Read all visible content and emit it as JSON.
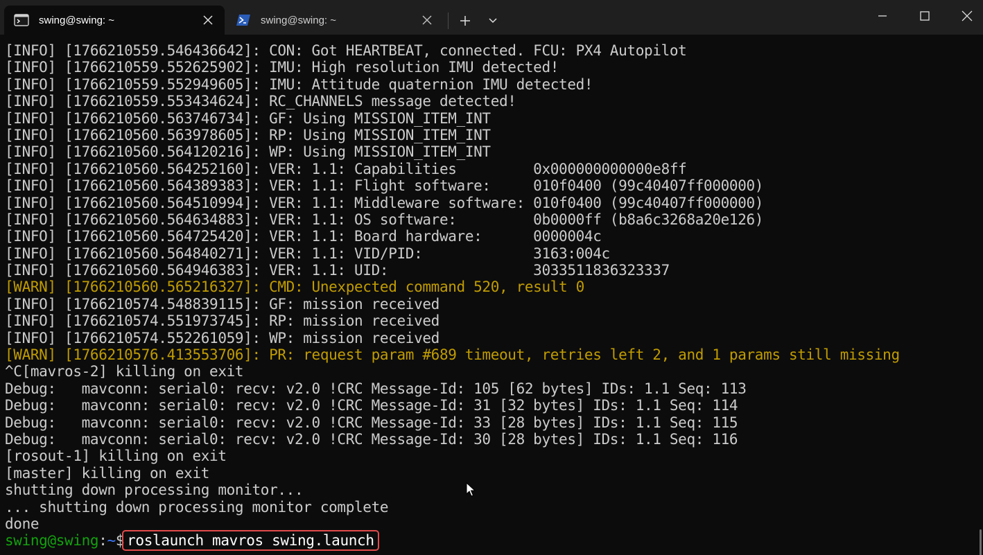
{
  "window": {
    "tabs": [
      {
        "title": "swing@swing: ~",
        "icon": "terminal-icon",
        "active": true
      },
      {
        "title": "swing@swing: ~",
        "icon": "powershell-icon",
        "active": false
      }
    ],
    "controls": [
      "minimize-icon",
      "maximize-icon",
      "close-icon"
    ]
  },
  "colors": {
    "text": "#cccccc",
    "warn": "#c19c00",
    "prompt_user": "#13a10e",
    "prompt_path": "#3b78ff",
    "highlight_box": "#e34b4b"
  },
  "terminal": {
    "lines": [
      {
        "text": "[INFO] [1766210559.546436642]: CON: Got HEARTBEAT, connected. FCU: PX4 Autopilot",
        "level": "info"
      },
      {
        "text": "[INFO] [1766210559.552625902]: IMU: High resolution IMU detected!",
        "level": "info"
      },
      {
        "text": "[INFO] [1766210559.552949605]: IMU: Attitude quaternion IMU detected!",
        "level": "info"
      },
      {
        "text": "[INFO] [1766210559.553434624]: RC_CHANNELS message detected!",
        "level": "info"
      },
      {
        "text": "[INFO] [1766210560.563746734]: GF: Using MISSION_ITEM_INT",
        "level": "info"
      },
      {
        "text": "[INFO] [1766210560.563978605]: RP: Using MISSION_ITEM_INT",
        "level": "info"
      },
      {
        "text": "[INFO] [1766210560.564120216]: WP: Using MISSION_ITEM_INT",
        "level": "info"
      },
      {
        "text": "[INFO] [1766210560.564252160]: VER: 1.1: Capabilities         0x000000000000e8ff",
        "level": "info"
      },
      {
        "text": "[INFO] [1766210560.564389383]: VER: 1.1: Flight software:     010f0400 (99c40407ff000000)",
        "level": "info"
      },
      {
        "text": "[INFO] [1766210560.564510994]: VER: 1.1: Middleware software: 010f0400 (99c40407ff000000)",
        "level": "info"
      },
      {
        "text": "[INFO] [1766210560.564634883]: VER: 1.1: OS software:         0b0000ff (b8a6c3268a20e126)",
        "level": "info"
      },
      {
        "text": "[INFO] [1766210560.564725420]: VER: 1.1: Board hardware:      0000004c",
        "level": "info"
      },
      {
        "text": "[INFO] [1766210560.564840271]: VER: 1.1: VID/PID:             3163:004c",
        "level": "info"
      },
      {
        "text": "[INFO] [1766210560.564946383]: VER: 1.1: UID:                 3033511836323337",
        "level": "info"
      },
      {
        "text": "[WARN] [1766210560.565216327]: CMD: Unexpected command 520, result 0",
        "level": "warn"
      },
      {
        "text": "[INFO] [1766210574.548839115]: GF: mission received",
        "level": "info"
      },
      {
        "text": "[INFO] [1766210574.551973745]: RP: mission received",
        "level": "info"
      },
      {
        "text": "[INFO] [1766210574.552261059]: WP: mission received",
        "level": "info"
      },
      {
        "text": "[WARN] [1766210576.413553706]: PR: request param #689 timeout, retries left 2, and 1 params still missing",
        "level": "warn"
      },
      {
        "text": "^C[mavros-2] killing on exit",
        "level": "plain"
      },
      {
        "text": "Debug:   mavconn: serial0: recv: v2.0 !CRC Message-Id: 105 [62 bytes] IDs: 1.1 Seq: 113",
        "level": "plain"
      },
      {
        "text": "Debug:   mavconn: serial0: recv: v2.0 !CRC Message-Id: 31 [32 bytes] IDs: 1.1 Seq: 114",
        "level": "plain"
      },
      {
        "text": "Debug:   mavconn: serial0: recv: v2.0 !CRC Message-Id: 33 [28 bytes] IDs: 1.1 Seq: 115",
        "level": "plain"
      },
      {
        "text": "Debug:   mavconn: serial0: recv: v2.0 !CRC Message-Id: 30 [28 bytes] IDs: 1.1 Seq: 116",
        "level": "plain"
      },
      {
        "text": "[rosout-1] killing on exit",
        "level": "plain"
      },
      {
        "text": "[master] killing on exit",
        "level": "plain"
      },
      {
        "text": "shutting down processing monitor...",
        "level": "plain"
      },
      {
        "text": "... shutting down processing monitor complete",
        "level": "plain"
      },
      {
        "text": "done",
        "level": "plain"
      }
    ],
    "prompt": {
      "user_host": "swing@swing",
      "colon": ":",
      "path": "~",
      "sign": "$",
      "command": "roslaunch mavros swing.launch"
    }
  }
}
